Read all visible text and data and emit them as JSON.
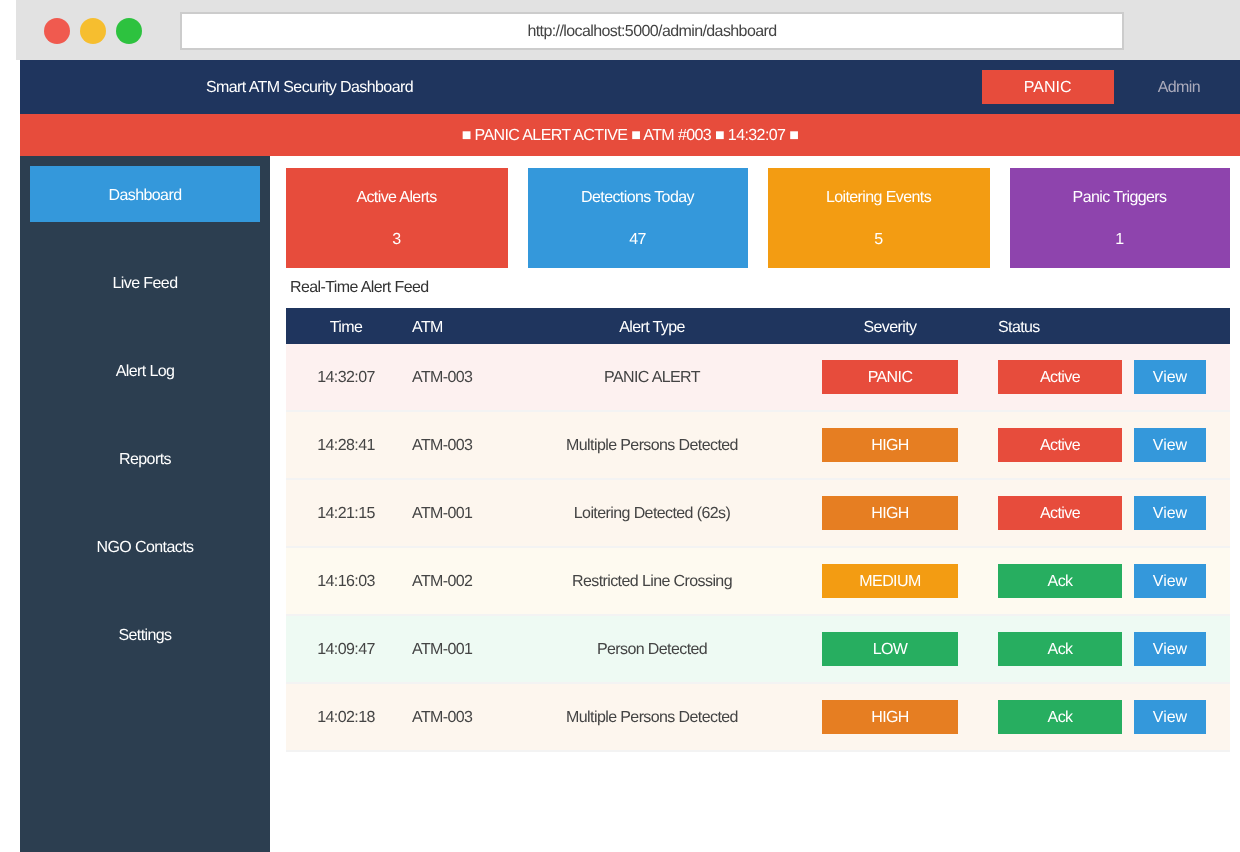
{
  "browser": {
    "url": "http://localhost:5000/admin/dashboard"
  },
  "navbar": {
    "title": "Smart ATM Security Dashboard",
    "panic_button": "PANIC",
    "user": "Admin"
  },
  "banner": "■ PANIC ALERT ACTIVE ■ ATM #003 ■ 14:32:07 ■",
  "sidebar": {
    "items": [
      {
        "label": "Dashboard",
        "selected": true
      },
      {
        "label": "Live Feed",
        "selected": false
      },
      {
        "label": "Alert Log",
        "selected": false
      },
      {
        "label": "Reports",
        "selected": false
      },
      {
        "label": "NGO Contacts",
        "selected": false
      },
      {
        "label": "Settings",
        "selected": false
      }
    ]
  },
  "cards": [
    {
      "label": "Active Alerts",
      "value": "3",
      "color": "#e74c3c"
    },
    {
      "label": "Detections Today",
      "value": "47",
      "color": "#3498db"
    },
    {
      "label": "Loitering Events",
      "value": "5",
      "color": "#f39c12"
    },
    {
      "label": "Panic Triggers",
      "value": "1",
      "color": "#8e44ad"
    }
  ],
  "feed": {
    "title": "Real-Time Alert Feed",
    "columns": [
      "Time",
      "ATM",
      "Alert Type",
      "Severity",
      "Status"
    ],
    "rows": [
      {
        "time": "14:32:07",
        "atm": "ATM-003",
        "type": "PANIC ALERT",
        "severity": {
          "label": "PANIC",
          "kind": "panic"
        },
        "status": {
          "label": "Active",
          "kind": "active"
        },
        "action": "View"
      },
      {
        "time": "14:28:41",
        "atm": "ATM-003",
        "type": "Multiple Persons Detected",
        "severity": {
          "label": "HIGH",
          "kind": "high"
        },
        "status": {
          "label": "Active",
          "kind": "active"
        },
        "action": "View"
      },
      {
        "time": "14:21:15",
        "atm": "ATM-001",
        "type": "Loitering Detected (62s)",
        "severity": {
          "label": "HIGH",
          "kind": "high"
        },
        "status": {
          "label": "Active",
          "kind": "active"
        },
        "action": "View"
      },
      {
        "time": "14:16:03",
        "atm": "ATM-002",
        "type": "Restricted Line Crossing",
        "severity": {
          "label": "MEDIUM",
          "kind": "medium"
        },
        "status": {
          "label": "Ack",
          "kind": "ack"
        },
        "action": "View"
      },
      {
        "time": "14:09:47",
        "atm": "ATM-001",
        "type": "Person Detected",
        "severity": {
          "label": "LOW",
          "kind": "low"
        },
        "status": {
          "label": "Ack",
          "kind": "ack"
        },
        "action": "View"
      },
      {
        "time": "14:02:18",
        "atm": "ATM-003",
        "type": "Multiple Persons Detected",
        "severity": {
          "label": "HIGH",
          "kind": "high"
        },
        "status": {
          "label": "Ack",
          "kind": "ack"
        },
        "action": "View"
      }
    ]
  }
}
